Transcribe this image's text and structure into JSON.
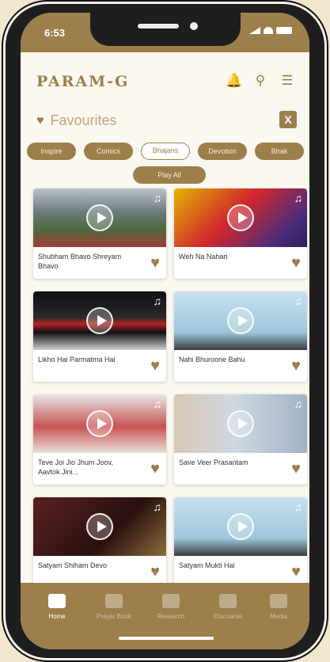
{
  "status": {
    "time": "6:53"
  },
  "header": {
    "logo": "PARAM-G"
  },
  "favourites": {
    "title": "Favourites",
    "close": "X"
  },
  "chips": [
    "Inspire",
    "Comics",
    "Bhajans",
    "Devotion",
    "Bhak"
  ],
  "active_chip_index": 2,
  "play_all": "Play All",
  "cards": [
    {
      "title": "Shubham Bhavo Shreyam Bhavo",
      "thumb": "t1"
    },
    {
      "title": "Weh Na Nahari",
      "thumb": "t2"
    },
    {
      "title": "Likho Hai Parmatma Hai",
      "thumb": "t3"
    },
    {
      "title": "Nahi Bhuroone Bahu",
      "thumb": "t4"
    },
    {
      "title": "Teve Joi Jio Jhum Joov, Aavtok Jini...",
      "thumb": "t5"
    },
    {
      "title": "Save Veer Prasantam",
      "thumb": "t6"
    },
    {
      "title": "Satyam Shiham Devo",
      "thumb": "t7"
    },
    {
      "title": "Satyam Mukti Hai",
      "thumb": "t8"
    }
  ],
  "nav": [
    {
      "label": "Home",
      "active": true
    },
    {
      "label": "Prayer Book",
      "active": false
    },
    {
      "label": "Research",
      "active": false
    },
    {
      "label": "Discourse",
      "active": false
    },
    {
      "label": "Media",
      "active": false
    }
  ],
  "colors": {
    "brand": "#9c7f4b",
    "background": "#fbf8f1"
  }
}
